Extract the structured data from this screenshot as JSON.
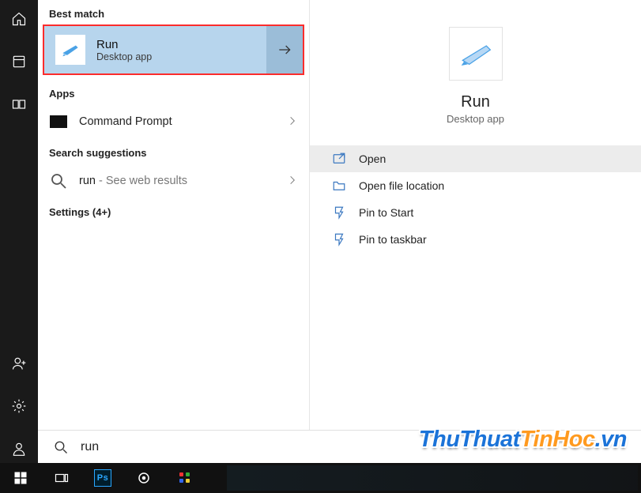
{
  "rail": {
    "items": [
      "home",
      "recent",
      "collections",
      "people",
      "settings",
      "account"
    ]
  },
  "results": {
    "best_match_label": "Best match",
    "best_match": {
      "title": "Run",
      "subtitle": "Desktop app"
    },
    "apps_label": "Apps",
    "apps": [
      {
        "label": "Command Prompt"
      }
    ],
    "suggestions_label": "Search suggestions",
    "suggestions": [
      {
        "term": "run",
        "tail": " - See web results"
      }
    ],
    "settings_label": "Settings (4+)"
  },
  "preview": {
    "title": "Run",
    "subtitle": "Desktop app",
    "actions": [
      {
        "label": "Open",
        "icon": "open",
        "selected": true
      },
      {
        "label": "Open file location",
        "icon": "folder",
        "selected": false
      },
      {
        "label": "Pin to Start",
        "icon": "pin",
        "selected": false
      },
      {
        "label": "Pin to taskbar",
        "icon": "pin",
        "selected": false
      }
    ]
  },
  "search": {
    "value": "run"
  },
  "watermark": {
    "t1": "ThuThuat",
    "t2": "TinHoc",
    "t3": ".vn"
  },
  "taskbar": {
    "items": [
      "start",
      "taskview",
      "photoshop",
      "cortana",
      "color-tool"
    ]
  }
}
